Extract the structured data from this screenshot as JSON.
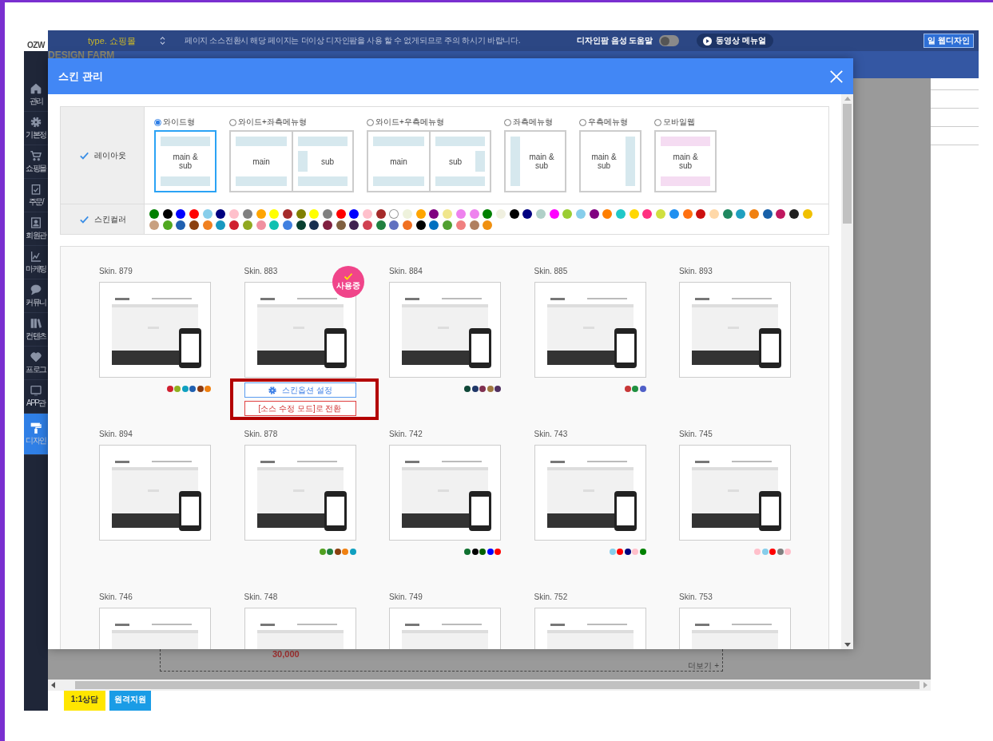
{
  "app": {
    "logo": "OZW",
    "brand": "DESIGN FARM",
    "type_label": "type. 쇼핑몰",
    "notice": "페이지 소스전환시 해당 페이지는 더이상 디자인팜을 사용 할 수 없게되므로 주의 하시기 바랍니다.",
    "voice_help": {
      "label": "디자인팜 음성 도움말",
      "on": false
    },
    "video_manual": "동영상 메뉴얼",
    "right_button": "일 웹디자인",
    "sidebar": [
      {
        "label": "관리",
        "kind": "home",
        "selected": false
      },
      {
        "label": "기본정",
        "kind": "gear",
        "selected": false
      },
      {
        "label": "쇼핑몰",
        "kind": "cart",
        "selected": false
      },
      {
        "label": "주문/",
        "kind": "clipboard",
        "selected": false
      },
      {
        "label": "회원관",
        "kind": "member",
        "selected": false
      },
      {
        "label": "마케팅",
        "kind": "chart",
        "selected": false
      },
      {
        "label": "커뮤니",
        "kind": "chat",
        "selected": false
      },
      {
        "label": "컨텐츠",
        "kind": "books",
        "selected": false
      },
      {
        "label": "프로그",
        "kind": "heart",
        "selected": false
      },
      {
        "label": "APP관",
        "kind": "tablet",
        "selected": false
      },
      {
        "label": "디자인",
        "kind": "roller",
        "selected": true
      }
    ],
    "bottom_buttons": [
      {
        "label": "1:1상담",
        "kind": "kakao"
      },
      {
        "label": "원격지원",
        "kind": "remote"
      }
    ],
    "behind": {
      "price": "30,000",
      "more": "더보기 +"
    }
  },
  "modal": {
    "title": "스킨 관리",
    "layout": {
      "label": "레이아웃",
      "options": [
        {
          "label": "와이드형",
          "kind": "wide",
          "selected": true,
          "captions": [
            "main & sub"
          ]
        },
        {
          "label": "와이드+좌측메뉴형",
          "kind": "wide-left",
          "selected": false,
          "captions": [
            "main",
            "sub"
          ]
        },
        {
          "label": "와이드+우측메뉴형",
          "kind": "wide-right",
          "selected": false,
          "captions": [
            "main",
            "sub"
          ]
        },
        {
          "label": "좌측메뉴형",
          "kind": "left",
          "selected": false,
          "captions": [
            "main & sub"
          ]
        },
        {
          "label": "우측메뉴형",
          "kind": "right",
          "selected": false,
          "captions": [
            "main & sub"
          ]
        },
        {
          "label": "모바일웹",
          "kind": "mobile",
          "selected": false,
          "captions": [
            "main & sub"
          ]
        }
      ]
    },
    "skin_color": {
      "label": "스킨컬러",
      "colors": [
        {
          "color": "#008000"
        },
        {
          "color": "#000000"
        },
        {
          "color": "#0000ff"
        },
        {
          "color": "#ff0000"
        },
        {
          "color": "#87ceeb"
        },
        {
          "color": "#000080"
        },
        {
          "color": "#ffc0cb"
        },
        {
          "color": "#808080"
        },
        {
          "color": "#ffa500"
        },
        {
          "color": "#ffff00"
        },
        {
          "color": "#a52a2a"
        },
        {
          "color": "#808000"
        },
        {
          "color": "#ffff00"
        },
        {
          "color": "#808080"
        },
        {
          "color": "#ff0000"
        },
        {
          "color": "#0000ff"
        },
        {
          "color": "#ffc0cb"
        },
        {
          "color": "#a52a2a"
        },
        {
          "color": "#ffffff"
        },
        {
          "color": "#eef2dc"
        },
        {
          "color": "#ffa500"
        },
        {
          "color": "#800080"
        },
        {
          "color": "#f0e68c"
        },
        {
          "color": "#ee82ee"
        },
        {
          "color": "#ee82ee"
        },
        {
          "color": "#008000"
        },
        {
          "color": "#f0f0e0"
        },
        {
          "color": "#000000"
        },
        {
          "color": "#000080"
        },
        {
          "color": "#b0d0c8"
        },
        {
          "color": "#ff00ff"
        },
        {
          "color": "#9acd32"
        },
        {
          "color": "#87ceeb"
        },
        {
          "color": "#800080"
        },
        {
          "color": "#ff7f00"
        },
        {
          "color": "#20c8c8"
        },
        {
          "color": "#ffd700"
        },
        {
          "color": "#ff3080"
        },
        {
          "color": "#d0e040"
        },
        {
          "color": "#2090f0"
        },
        {
          "color": "#ff7010"
        },
        {
          "color": "#cc1010"
        },
        {
          "color": "#ffd8a8"
        },
        {
          "color": "#208860"
        },
        {
          "color": "#20a0c0"
        },
        {
          "color": "#f08010"
        },
        {
          "color": "#1860a8"
        },
        {
          "color": "#c01860"
        },
        {
          "color": "#202020"
        },
        {
          "color": "#f0c000"
        },
        {
          "color": "#c8a080"
        },
        {
          "color": "#50a820"
        },
        {
          "color": "#2060b0"
        },
        {
          "color": "#8b4010"
        },
        {
          "color": "#f08020"
        },
        {
          "color": "#1898c0"
        },
        {
          "color": "#d02030"
        },
        {
          "color": "#90a820"
        },
        {
          "color": "#f090a0"
        },
        {
          "color": "#10c0b0"
        },
        {
          "color": "#4080e0"
        },
        {
          "color": "#084030"
        },
        {
          "color": "#183050"
        },
        {
          "color": "#802040"
        },
        {
          "color": "#806040"
        },
        {
          "color": "#402050"
        },
        {
          "color": "#d04050"
        },
        {
          "color": "#208040"
        },
        {
          "color": "#6070c0"
        },
        {
          "color": "#f07020"
        },
        {
          "color": "#000000"
        },
        {
          "color": "#0070c0"
        },
        {
          "color": "#50a030"
        },
        {
          "color": "#f08080"
        },
        {
          "color": "#b08060"
        },
        {
          "color": "#f09010"
        }
      ]
    },
    "skins": {
      "in_use_badge": "사용중",
      "items": [
        {
          "name": "Skin. 879",
          "in_use": false,
          "colors": [
            {
              "color": "#d02030"
            },
            {
              "color": "#90b020"
            },
            {
              "color": "#10a0c0"
            },
            {
              "color": "#2060b0"
            },
            {
              "color": "#8b3a10"
            },
            {
              "color": "#f08010"
            }
          ]
        },
        {
          "name": "Skin. 883",
          "in_use": true,
          "actions": [
            {
              "label": "스킨옵션 설정",
              "kind": "options"
            },
            {
              "label": "[소스 수정 모드]로 전환",
              "kind": "source"
            }
          ]
        },
        {
          "name": "Skin. 884",
          "in_use": false,
          "colors": [
            {
              "color": "#104838"
            },
            {
              "color": "#203868"
            },
            {
              "color": "#803050"
            },
            {
              "color": "#a07840"
            },
            {
              "color": "#503060"
            }
          ]
        },
        {
          "name": "Skin. 885",
          "in_use": false,
          "colors": [
            {
              "color": "#c83838"
            },
            {
              "color": "#209040"
            },
            {
              "color": "#5060c8"
            }
          ]
        },
        {
          "name": "Skin. 893",
          "in_use": false
        },
        {
          "name": "Skin. 894",
          "in_use": false
        },
        {
          "name": "Skin. 878",
          "in_use": false,
          "colors": [
            {
              "color": "#50a020"
            },
            {
              "color": "#208040"
            },
            {
              "color": "#8b4010"
            },
            {
              "color": "#f08010"
            },
            {
              "color": "#10a0c0"
            }
          ]
        },
        {
          "name": "Skin. 742",
          "in_use": false,
          "colors": [
            {
              "color": "#107030"
            },
            {
              "color": "#000000"
            },
            {
              "color": "#006000"
            },
            {
              "color": "#0000ff"
            },
            {
              "color": "#ff0000"
            }
          ]
        },
        {
          "name": "Skin. 743",
          "in_use": false,
          "colors": [
            {
              "color": "#87ceeb"
            },
            {
              "color": "#ff0000"
            },
            {
              "color": "#000080"
            },
            {
              "color": "#ffc0cb"
            },
            {
              "color": "#008000"
            }
          ]
        },
        {
          "name": "Skin. 745",
          "in_use": false,
          "colors": [
            {
              "color": "#ffc0cb"
            },
            {
              "color": "#87ceeb"
            },
            {
              "color": "#ff0000"
            },
            {
              "color": "#808080"
            },
            {
              "color": "#ffc0cb"
            }
          ]
        },
        {
          "name": "Skin. 746",
          "in_use": false
        },
        {
          "name": "Skin. 748",
          "in_use": false
        },
        {
          "name": "Skin. 749",
          "in_use": false
        },
        {
          "name": "Skin. 752",
          "in_use": false
        },
        {
          "name": "Skin. 753",
          "in_use": false
        }
      ]
    }
  }
}
